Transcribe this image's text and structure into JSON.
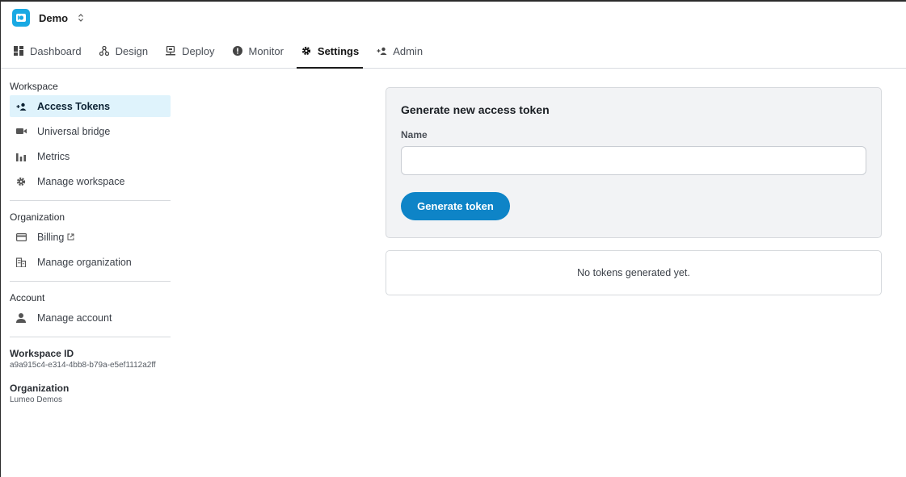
{
  "header": {
    "workspace_name": "Demo"
  },
  "tabs": [
    {
      "label": "Dashboard",
      "icon": "dashboard-icon"
    },
    {
      "label": "Design",
      "icon": "design-icon"
    },
    {
      "label": "Deploy",
      "icon": "deploy-icon"
    },
    {
      "label": "Monitor",
      "icon": "info-icon"
    },
    {
      "label": "Settings",
      "icon": "gear-icon",
      "active": true
    },
    {
      "label": "Admin",
      "icon": "admin-icon"
    }
  ],
  "sidebar": {
    "workspace": {
      "title": "Workspace",
      "items": [
        {
          "label": "Access Tokens",
          "icon": "access-tokens-icon",
          "active": true
        },
        {
          "label": "Universal bridge",
          "icon": "video-camera-icon"
        },
        {
          "label": "Metrics",
          "icon": "bar-chart-icon"
        },
        {
          "label": "Manage workspace",
          "icon": "gear-icon"
        }
      ]
    },
    "organization": {
      "title": "Organization",
      "items": [
        {
          "label": "Billing",
          "icon": "credit-card-icon",
          "external": true
        },
        {
          "label": "Manage organization",
          "icon": "building-icon"
        }
      ]
    },
    "account": {
      "title": "Account",
      "items": [
        {
          "label": "Manage account",
          "icon": "person-icon"
        }
      ]
    },
    "meta": {
      "workspace_id_label": "Workspace ID",
      "workspace_id_value": "a9a915c4-e314-4bb8-b79a-e5ef1112a2ff",
      "organization_label": "Organization",
      "organization_value": "Lumeo Demos"
    }
  },
  "token_form": {
    "title": "Generate new access token",
    "name_label": "Name",
    "name_value": "",
    "button_label": "Generate token"
  },
  "token_list": {
    "empty_text": "No tokens generated yet."
  },
  "colors": {
    "accent": "#0e84c7",
    "logo": "#19a9e3",
    "active_bg": "#dff3fc"
  }
}
